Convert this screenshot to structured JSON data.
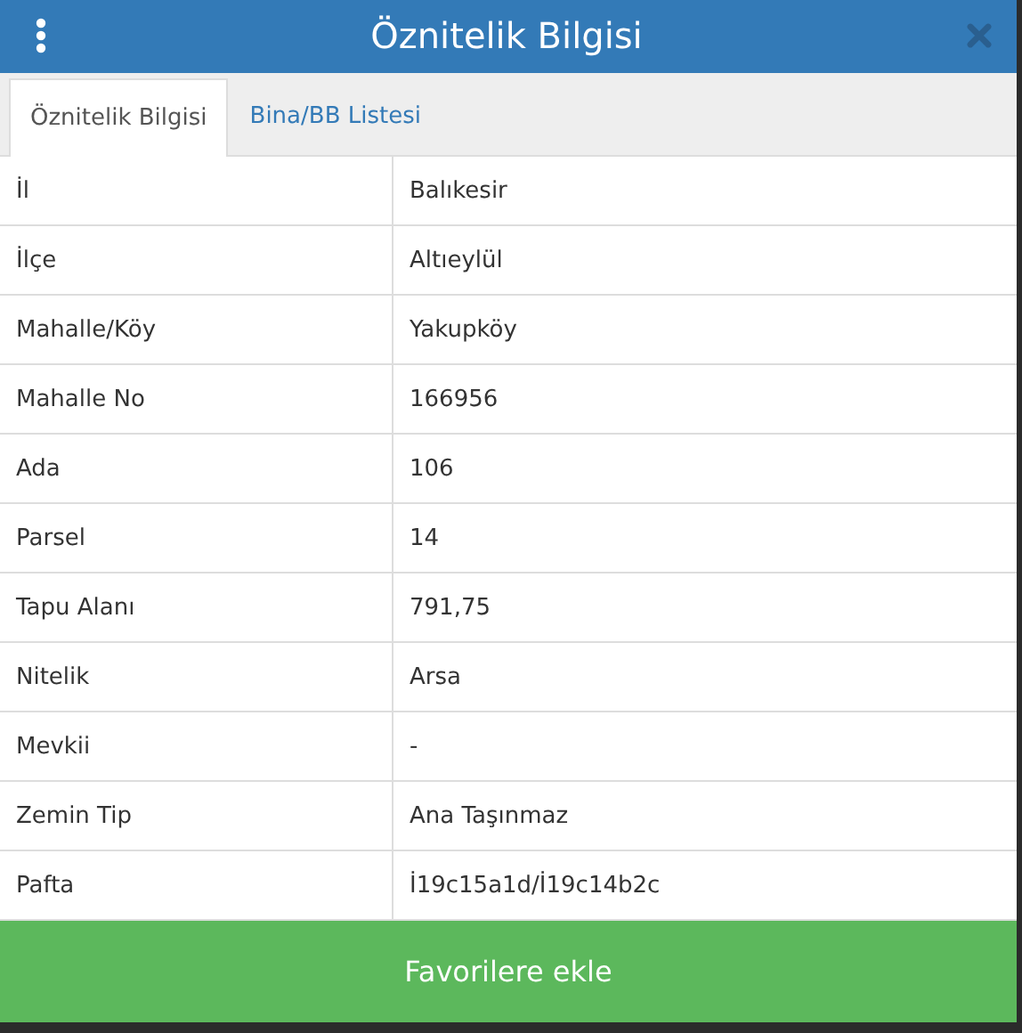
{
  "window": {
    "title": "Öznitelik Bilgisi"
  },
  "tabs": [
    {
      "label": "Öznitelik Bilgisi",
      "selected": true
    },
    {
      "label": "Bina/BB Listesi",
      "selected": false
    }
  ],
  "table": {
    "rows": [
      {
        "label": "İl",
        "value": "Balıkesir"
      },
      {
        "label": "İlçe",
        "value": "Altıeylül"
      },
      {
        "label": "Mahalle/Köy",
        "value": "Yakupköy"
      },
      {
        "label": "Mahalle No",
        "value": "166956"
      },
      {
        "label": "Ada",
        "value": "106"
      },
      {
        "label": "Parsel",
        "value": "14"
      },
      {
        "label": "Tapu Alanı",
        "value": "791,75"
      },
      {
        "label": "Nitelik",
        "value": "Arsa"
      },
      {
        "label": "Mevkii",
        "value": "-"
      },
      {
        "label": "Zemin Tip",
        "value": "Ana Taşınmaz"
      },
      {
        "label": "Pafta",
        "value": "İ19c15a1d/İ19c14b2c"
      }
    ]
  },
  "buttons": [
    "Favorilere ekle"
  ]
}
